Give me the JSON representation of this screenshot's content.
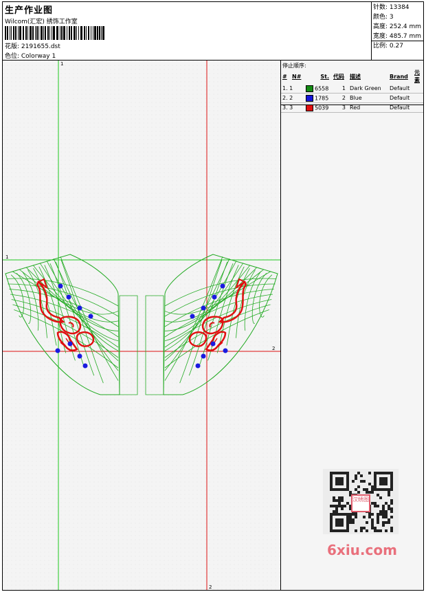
{
  "header": {
    "title": "生产作业图",
    "company": "Wilcom(汇宏) 绣饰工作室",
    "design_label": "花版: 2191655.dst",
    "colorway_label": "色位:  Colorway 1"
  },
  "stats": {
    "stitches": "针数: 13384",
    "colors": "颜色: 3",
    "height": "高度: 252.4 mm",
    "width": "宽度: 485.7 mm",
    "ratio": "比例: 0.27"
  },
  "guides": {
    "v1_label": "1",
    "h1_label": "1",
    "h2_label": "2",
    "v2_label": "2"
  },
  "stop_sequence": {
    "heading": "停止顺序:",
    "columns": [
      "#",
      "N#",
      "St.",
      "代码",
      "描述",
      "Brand",
      "元素"
    ],
    "rows": [
      {
        "idx": "1. 1",
        "stitches": "6558",
        "code": "1",
        "desc": "Dark Green",
        "brand": "Default",
        "color": "#128a12"
      },
      {
        "idx": "2. 2",
        "stitches": "1785",
        "code": "2",
        "desc": "Blue",
        "brand": "Default",
        "color": "#1414d8"
      },
      {
        "idx": "3. 3",
        "stitches": "5039",
        "code": "3",
        "desc": "Red",
        "brand": "Default",
        "color": "#e01010"
      }
    ]
  },
  "qr_logo": "汉绣图",
  "watermark": "6xiu.com",
  "colors": {
    "green": "#22aa22",
    "red": "#e01010",
    "blue": "#1a1ae0",
    "guide_green": "#1ec81e",
    "guide_red": "#dd1111"
  }
}
